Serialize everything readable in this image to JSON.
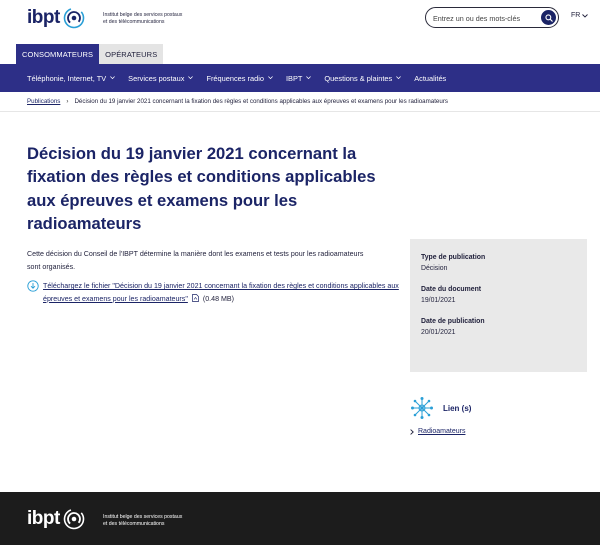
{
  "header": {
    "logo_text": "ibpt",
    "tagline_line1": "Institut belge des services postaux",
    "tagline_line2": "et des télécommunications",
    "search_placeholder": "Entrez un ou des mots-clés",
    "language": "FR"
  },
  "audience_tabs": [
    {
      "label": "CONSOMMATEURS",
      "active": true
    },
    {
      "label": "OPÉRATEURS",
      "active": false
    }
  ],
  "nav": [
    {
      "label": "Téléphonie, Internet, TV",
      "has_dropdown": true
    },
    {
      "label": "Services postaux",
      "has_dropdown": true
    },
    {
      "label": "Fréquences radio",
      "has_dropdown": true
    },
    {
      "label": "IBPT",
      "has_dropdown": true
    },
    {
      "label": "Questions & plaintes",
      "has_dropdown": true
    },
    {
      "label": "Actualités",
      "has_dropdown": false
    }
  ],
  "breadcrumb": {
    "parent": "Publications",
    "current": "Décision du 19 janvier 2021 concernant la fixation des règles et conditions applicables aux épreuves et examens pour les radioamateurs"
  },
  "page_title": "Décision du 19 janvier 2021 concernant la fixation des règles et conditions applicables aux épreuves et examens pour les radioamateurs",
  "intro": "Cette décision du Conseil de l'IBPT détermine la manière dont les examens et tests pour les radioamateurs sont organisés.",
  "download": {
    "link_text": "Téléchargez le fichier \"Décision du 19 janvier 2021 concernant la fixation des règles et conditions applicables aux épreuves et examens pour les radioamateurs\"",
    "size": "(0.48 MB)"
  },
  "meta": {
    "type_label": "Type de publication",
    "type_value": "Décision",
    "doc_date_label": "Date du document",
    "doc_date_value": "19/01/2021",
    "pub_date_label": "Date de publication",
    "pub_date_value": "20/01/2021"
  },
  "links": {
    "heading": "Lien (s)",
    "items": [
      "Radioamateurs"
    ]
  },
  "footer": {
    "logo_text": "ibpt",
    "tagline_line1": "Institut belge des services postaux",
    "tagline_line2": "et des télécommunications"
  },
  "colors": {
    "brand_navy": "#1b2466",
    "nav_blue": "#2d2f87",
    "meta_bg": "#e9e9e9",
    "footer_bg": "#1c1c1c"
  }
}
